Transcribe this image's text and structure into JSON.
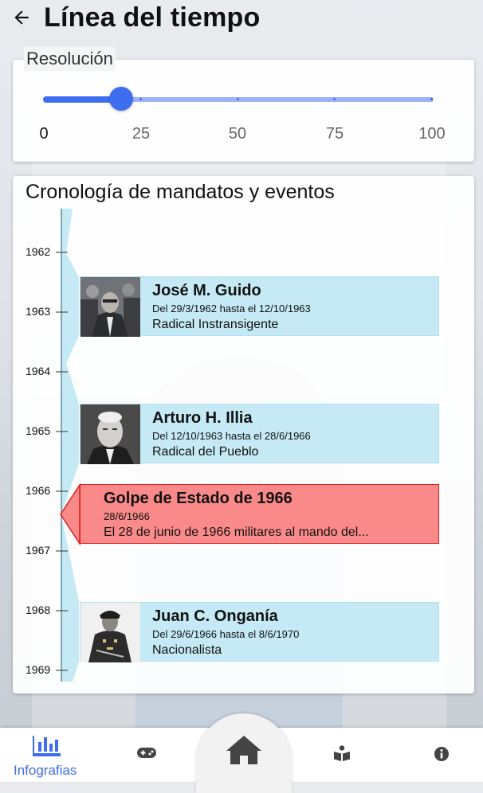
{
  "header": {
    "title": "Línea del tiempo"
  },
  "resolution": {
    "label": "Resolución",
    "value": 20,
    "min": 0,
    "max": 100,
    "ticks": [
      "0",
      "25",
      "50",
      "75",
      "100"
    ]
  },
  "chronology": {
    "title": "Cronología de mandatos y eventos",
    "years": [
      "1962",
      "1963",
      "1964",
      "1965",
      "1966",
      "1967",
      "1968",
      "1969"
    ],
    "mandates": [
      {
        "name": "José M. Guido",
        "dates": "Del 29/3/1962 hasta el 12/10/1963",
        "party": "Radical Instransigente"
      },
      {
        "name": "Arturo H. Illia",
        "dates": "Del 12/10/1963 hasta el 28/6/1966",
        "party": "Radical del Pueblo"
      },
      {
        "name": "Juan C. Onganía",
        "dates": "Del 29/6/1966 hasta el 8/6/1970",
        "party": "Nacionalista"
      }
    ],
    "event": {
      "title": "Golpe de Estado de 1966",
      "date": "28/6/1966",
      "description": "El 28 de junio de 1966 militares al mando del..."
    }
  },
  "nav": {
    "items": [
      {
        "label": "Infografias",
        "icon": "chart-bar-icon",
        "active": true
      },
      {
        "icon": "gamepad-icon"
      },
      {
        "icon": "home-icon"
      },
      {
        "icon": "book-reader-icon"
      },
      {
        "icon": "info-circle-icon"
      }
    ]
  },
  "colors": {
    "accent": "#3f6df0",
    "mandate": "#c5eaf5",
    "event": "#fa8a8a",
    "eventBorder": "#e02020"
  }
}
